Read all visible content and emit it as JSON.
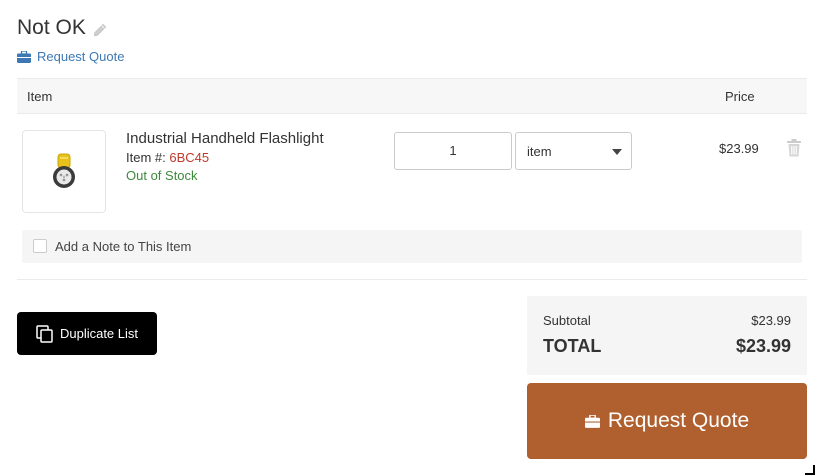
{
  "list": {
    "title": "Not OK",
    "request_quote_link": "Request Quote"
  },
  "table": {
    "col_item": "Item",
    "col_price": "Price"
  },
  "items": [
    {
      "name": "Industrial Handheld Flashlight",
      "sku_label": "Item #:",
      "sku": "6BC45",
      "stock_status": "Out of Stock",
      "quantity": "1",
      "unit": "item",
      "price": "$23.99",
      "note_label": "Add a Note to This Item"
    }
  ],
  "actions": {
    "duplicate_label": "Duplicate List",
    "request_quote_label": "Request Quote"
  },
  "summary": {
    "subtotal_label": "Subtotal",
    "subtotal_value": "$23.99",
    "total_label": "TOTAL",
    "total_value": "$23.99"
  },
  "colors": {
    "link_blue": "#3d78b5",
    "sku_red": "#c0392b",
    "stock_green": "#3c8a3c",
    "quote_button": "#b0602e",
    "duplicate_button": "#000000"
  },
  "icons": [
    "pencil-icon",
    "briefcase-icon",
    "trash-icon",
    "copy-icon",
    "checkbox-icon",
    "caret-down-icon"
  ]
}
